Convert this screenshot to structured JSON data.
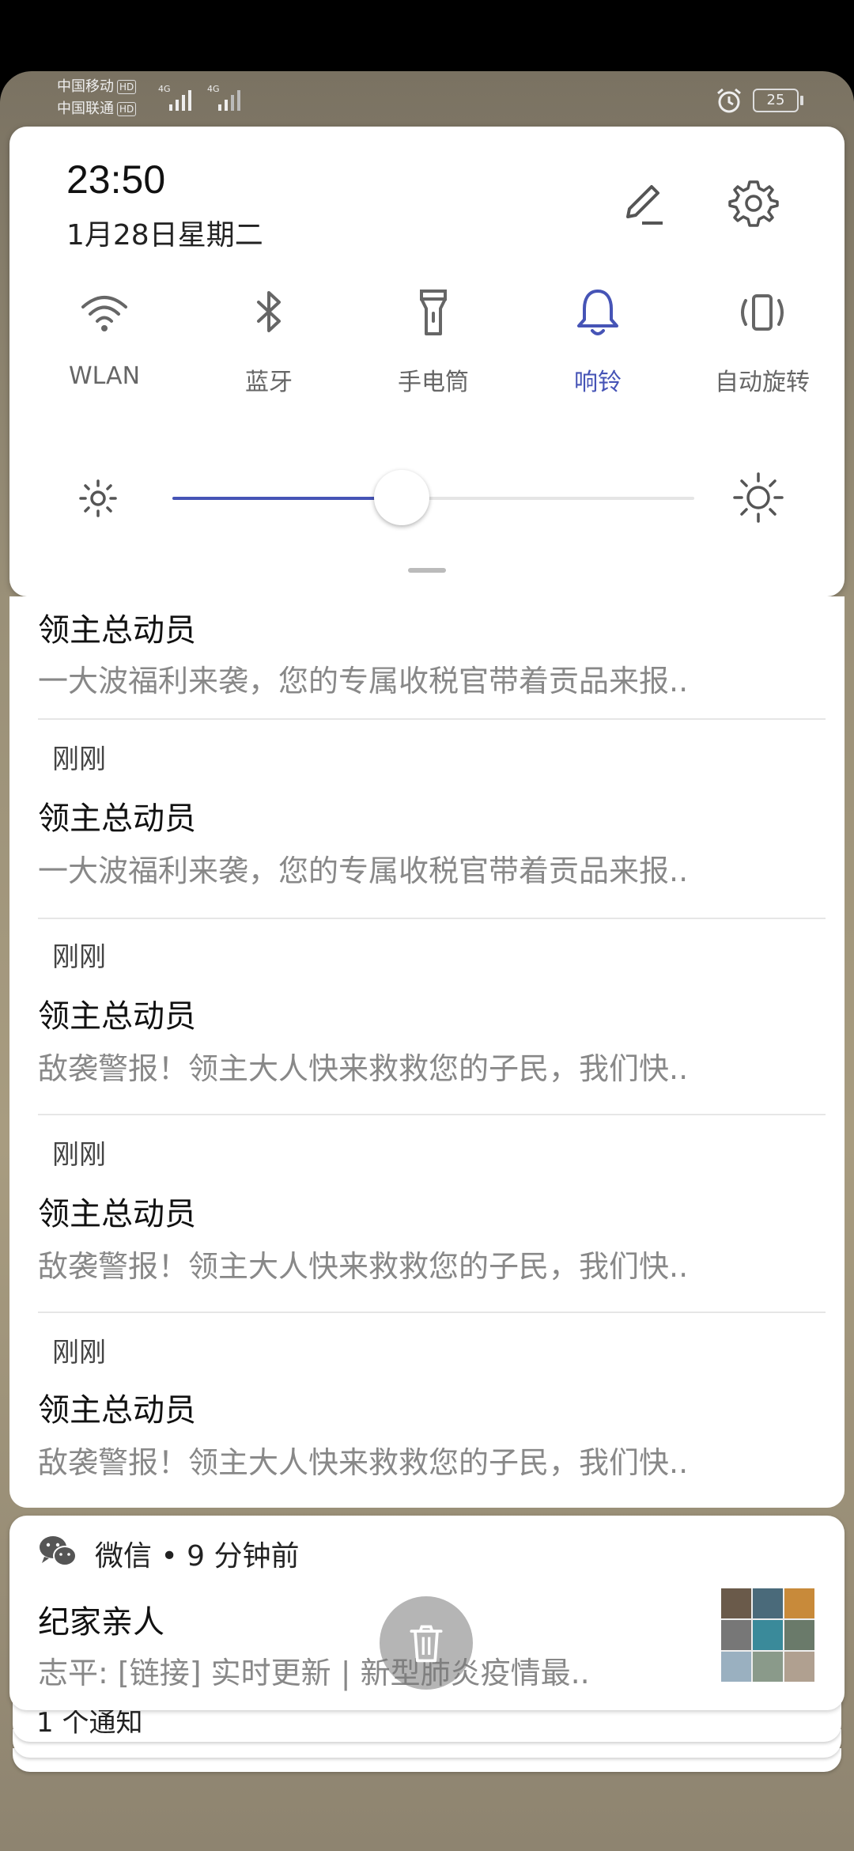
{
  "status_bar": {
    "carrier1": "中国移动",
    "carrier2": "中国联通",
    "hd": "HD",
    "network1": "4G",
    "network2": "4G",
    "battery": "25"
  },
  "quick_settings": {
    "time": "23:50",
    "date": "1月28日星期二",
    "tiles": [
      {
        "label": "WLAN",
        "icon": "wifi-icon",
        "active": false
      },
      {
        "label": "蓝牙",
        "icon": "bluetooth-icon",
        "active": false
      },
      {
        "label": "手电筒",
        "icon": "flashlight-icon",
        "active": false
      },
      {
        "label": "响铃",
        "icon": "bell-icon",
        "active": true
      },
      {
        "label": "自动旋转",
        "icon": "auto-rotate-icon",
        "active": false
      }
    ],
    "brightness": 0.44,
    "accent_color": "#4654b6"
  },
  "notifications": [
    {
      "ago": "",
      "title": "领主总动员",
      "text": "一大波福利来袭，您的专属收税官带着贡品来报.."
    },
    {
      "ago": "刚刚",
      "title": "领主总动员",
      "text": "一大波福利来袭，您的专属收税官带着贡品来报.."
    },
    {
      "ago": "刚刚",
      "title": "领主总动员",
      "text": "敌袭警报！领主大人快来救救您的子民，我们快.."
    },
    {
      "ago": "刚刚",
      "title": "领主总动员",
      "text": "敌袭警报！领主大人快来救救您的子民，我们快.."
    },
    {
      "ago": "刚刚",
      "title": "领主总动员",
      "text": "敌袭警报！领主大人快来救救您的子民，我们快.."
    }
  ],
  "wechat": {
    "app": "微信 • 9 分钟前",
    "title": "纪家亲人",
    "text": "志平: [链接] 实时更新 | 新型肺炎疫情最..",
    "stack_label": "1 个通知"
  }
}
